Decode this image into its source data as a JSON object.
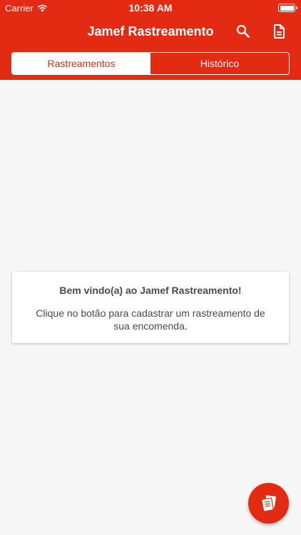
{
  "status_bar": {
    "carrier": "Carrier",
    "time": "10:38 AM"
  },
  "navbar": {
    "title": "Jamef Rastreamento",
    "icons": [
      "search-icon",
      "document-icon"
    ]
  },
  "tabs": [
    {
      "label": "Rastreamentos",
      "active": true
    },
    {
      "label": "Histórico",
      "active": false
    }
  ],
  "welcome_card": {
    "heading": "Bem vindo(a) ao Jamef Rastreamento!",
    "message": "Clique no botão para cadastrar um rastreamento de sua encomenda."
  },
  "fab": {
    "icon": "add-tracking-icon"
  },
  "colors": {
    "primary": "#e32b13",
    "background": "#f6f6f6",
    "text": "#4a4a4a"
  }
}
